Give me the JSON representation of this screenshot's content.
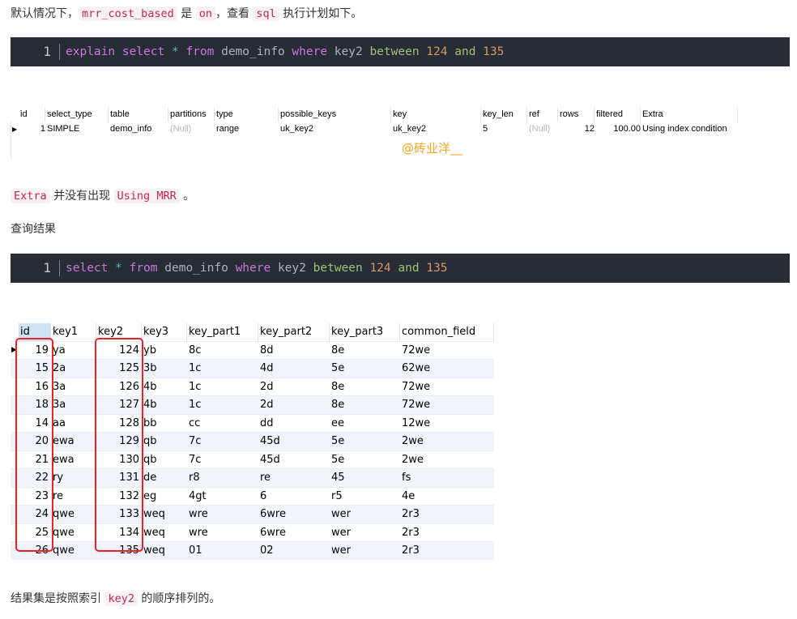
{
  "intro": {
    "p1_prefix": "默认情况下，",
    "p1_code1": "mrr_cost_based",
    "p1_mid": " 是 ",
    "p1_code2": "on",
    "p1_mid2": "，查看 ",
    "p1_code3": "sql",
    "p1_suffix": " 执行计划如下。"
  },
  "code1": {
    "line_no": "1",
    "t1": "explain",
    "t2": "select",
    "t3": "*",
    "t4": "from",
    "t5": "demo_info",
    "t6": "where",
    "t7": "key2",
    "t8": "between",
    "t9": "124",
    "t10": "and",
    "t11": "135"
  },
  "explain": {
    "headers": [
      "id",
      "select_type",
      "table",
      "partitions",
      "type",
      "possible_keys",
      "key",
      "key_len",
      "ref",
      "rows",
      "filtered",
      "Extra"
    ],
    "row": [
      "1",
      "SIMPLE",
      "demo_info",
      "(Null)",
      "range",
      "uk_key2",
      "uk_key2",
      "5",
      "(Null)",
      "12",
      "100.00",
      "Using index condition"
    ],
    "marker": "▶",
    "watermark": "@砖业洋__"
  },
  "p2": {
    "code": "Extra",
    "text": " 并没有出现 ",
    "code2": "Using MRR",
    "suffix": " 。"
  },
  "p3": {
    "text": "查询结果"
  },
  "code2": {
    "line_no": "1",
    "t1": "select",
    "t2": "*",
    "t3": "from",
    "t4": "demo_info",
    "t5": "where",
    "t6": "key2",
    "t7": "between",
    "t8": "124",
    "t9": "and",
    "t10": "135"
  },
  "result": {
    "headers": [
      "id",
      "key1",
      "key2",
      "key3",
      "key_part1",
      "key_part2",
      "key_part3",
      "common_field"
    ],
    "rows": [
      [
        "19",
        "ya",
        "124",
        "yb",
        "8c",
        "8d",
        "8e",
        "72we"
      ],
      [
        "15",
        "2a",
        "125",
        "3b",
        "1c",
        "4d",
        "5e",
        "62we"
      ],
      [
        "16",
        "3a",
        "126",
        "4b",
        "1c",
        "2d",
        "8e",
        "72we"
      ],
      [
        "18",
        "3a",
        "127",
        "4b",
        "1c",
        "2d",
        "8e",
        "72we"
      ],
      [
        "14",
        "aa",
        "128",
        "bb",
        "cc",
        "dd",
        "ee",
        "12we"
      ],
      [
        "20",
        "ewa",
        "129",
        "qb",
        "7c",
        "45d",
        "5e",
        "2we"
      ],
      [
        "21",
        "ewa",
        "130",
        "qb",
        "7c",
        "45d",
        "5e",
        "2we"
      ],
      [
        "22",
        "ry",
        "131",
        "de",
        "r8",
        "re",
        "45",
        "fs"
      ],
      [
        "23",
        "re",
        "132",
        "eg",
        "4gt",
        "6",
        "r5",
        "4e"
      ],
      [
        "24",
        "qwe",
        "133",
        "weq",
        "wre",
        "6wre",
        "wer",
        "2r3"
      ],
      [
        "25",
        "qwe",
        "134",
        "weq",
        "wre",
        "6wre",
        "wer",
        "2r3"
      ],
      [
        "26",
        "qwe",
        "135",
        "weq",
        "01",
        "02",
        "wer",
        "2r3"
      ]
    ],
    "marker": "▶"
  },
  "p4": {
    "prefix": "结果集是按照索引 ",
    "code": "key2",
    "suffix": " 的顺序排列的。"
  },
  "colors": {
    "code_bg": "#282c34",
    "inline_code": "#c7254e",
    "highlight_box": "#e8242a",
    "watermark": "#f5a623"
  }
}
